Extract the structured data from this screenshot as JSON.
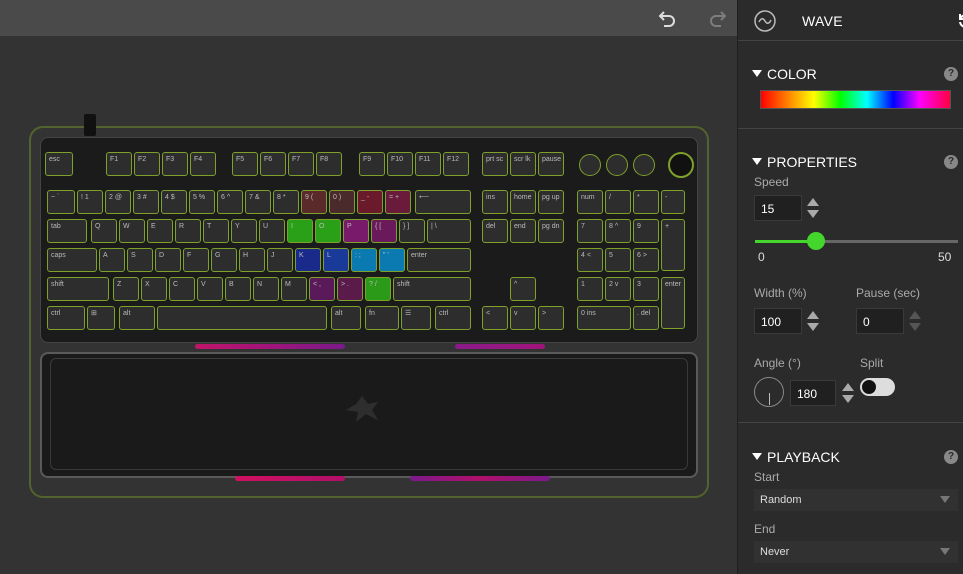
{
  "toolbar": {
    "undo": "undo-icon",
    "redo": "redo-icon"
  },
  "panel": {
    "title": "WAVE",
    "color_section": "COLOR",
    "properties_section": "PROPERTIES",
    "speed_label": "Speed",
    "speed_value": "15",
    "speed_min": "0",
    "speed_max": "50",
    "speed_fraction": 0.3,
    "width_label": "Width (%)",
    "width_value": "100",
    "pause_label": "Pause (sec)",
    "pause_value": "0",
    "angle_label": "Angle (°)",
    "angle_value": "180",
    "split_label": "Split",
    "playback_section": "PLAYBACK",
    "start_label": "Start",
    "start_value": "Random",
    "end_label": "End",
    "end_value": "Never",
    "help": "?"
  },
  "colors": {
    "accent": "#44d62c",
    "key_outline": "#7fa12a"
  },
  "keyboard": {
    "keys": [
      {
        "t": "esc"
      },
      {
        "t": "F1"
      },
      {
        "t": "F2"
      },
      {
        "t": "F3"
      },
      {
        "t": "F4"
      },
      {
        "t": "F5"
      },
      {
        "t": "F6"
      },
      {
        "t": "F7"
      },
      {
        "t": "F8"
      },
      {
        "t": "F9"
      },
      {
        "t": "F10"
      },
      {
        "t": "F11"
      },
      {
        "t": "F12"
      },
      {
        "t": "prt sc"
      },
      {
        "t": "scr lk"
      },
      {
        "t": "pause"
      },
      {
        "t": "~ `"
      },
      {
        "t": "! 1"
      },
      {
        "t": "2 @"
      },
      {
        "t": "3 #"
      },
      {
        "t": "4 $"
      },
      {
        "t": "5 %"
      },
      {
        "t": "6 ^"
      },
      {
        "t": "7 &"
      },
      {
        "t": "8 *"
      },
      {
        "t": "9 ("
      },
      {
        "t": "0 )"
      },
      {
        "t": "_ -"
      },
      {
        "t": "= +"
      },
      {
        "t": "⟵"
      },
      {
        "t": "ins"
      },
      {
        "t": "home"
      },
      {
        "t": "pg up"
      },
      {
        "t": "num"
      },
      {
        "t": "/"
      },
      {
        "t": "*"
      },
      {
        "t": "-"
      },
      {
        "t": "tab"
      },
      {
        "t": "Q"
      },
      {
        "t": "W"
      },
      {
        "t": "E"
      },
      {
        "t": "R"
      },
      {
        "t": "T"
      },
      {
        "t": "Y"
      },
      {
        "t": "U"
      },
      {
        "t": "I"
      },
      {
        "t": "O"
      },
      {
        "t": "P"
      },
      {
        "t": "{ ["
      },
      {
        "t": "} ]"
      },
      {
        "t": "| \\"
      },
      {
        "t": "del"
      },
      {
        "t": "end"
      },
      {
        "t": "pg dn"
      },
      {
        "t": "7"
      },
      {
        "t": "8 ^"
      },
      {
        "t": "9"
      },
      {
        "t": "+"
      },
      {
        "t": "caps"
      },
      {
        "t": "A"
      },
      {
        "t": "S"
      },
      {
        "t": "D"
      },
      {
        "t": "F"
      },
      {
        "t": "G"
      },
      {
        "t": "H"
      },
      {
        "t": "J"
      },
      {
        "t": "K"
      },
      {
        "t": "L"
      },
      {
        "t": ": ;"
      },
      {
        "t": "\" '"
      },
      {
        "t": "enter"
      },
      {
        "t": "4 <"
      },
      {
        "t": "5"
      },
      {
        "t": "6 >"
      },
      {
        "t": "shift"
      },
      {
        "t": "Z"
      },
      {
        "t": "X"
      },
      {
        "t": "C"
      },
      {
        "t": "V"
      },
      {
        "t": "B"
      },
      {
        "t": "N"
      },
      {
        "t": "M"
      },
      {
        "t": "< ,"
      },
      {
        "t": "> ."
      },
      {
        "t": "? /"
      },
      {
        "t": "shift"
      },
      {
        "t": "^"
      },
      {
        "t": "1"
      },
      {
        "t": "2 v"
      },
      {
        "t": "3"
      },
      {
        "t": "enter"
      },
      {
        "t": "ctrl"
      },
      {
        "t": "⊞"
      },
      {
        "t": "alt"
      },
      {
        "t": ""
      },
      {
        "t": "alt"
      },
      {
        "t": "fn"
      },
      {
        "t": "☰"
      },
      {
        "t": "ctrl"
      },
      {
        "t": "<"
      },
      {
        "t": "v"
      },
      {
        "t": ">"
      },
      {
        "t": "0 ins"
      },
      {
        "t": ". del"
      }
    ]
  }
}
